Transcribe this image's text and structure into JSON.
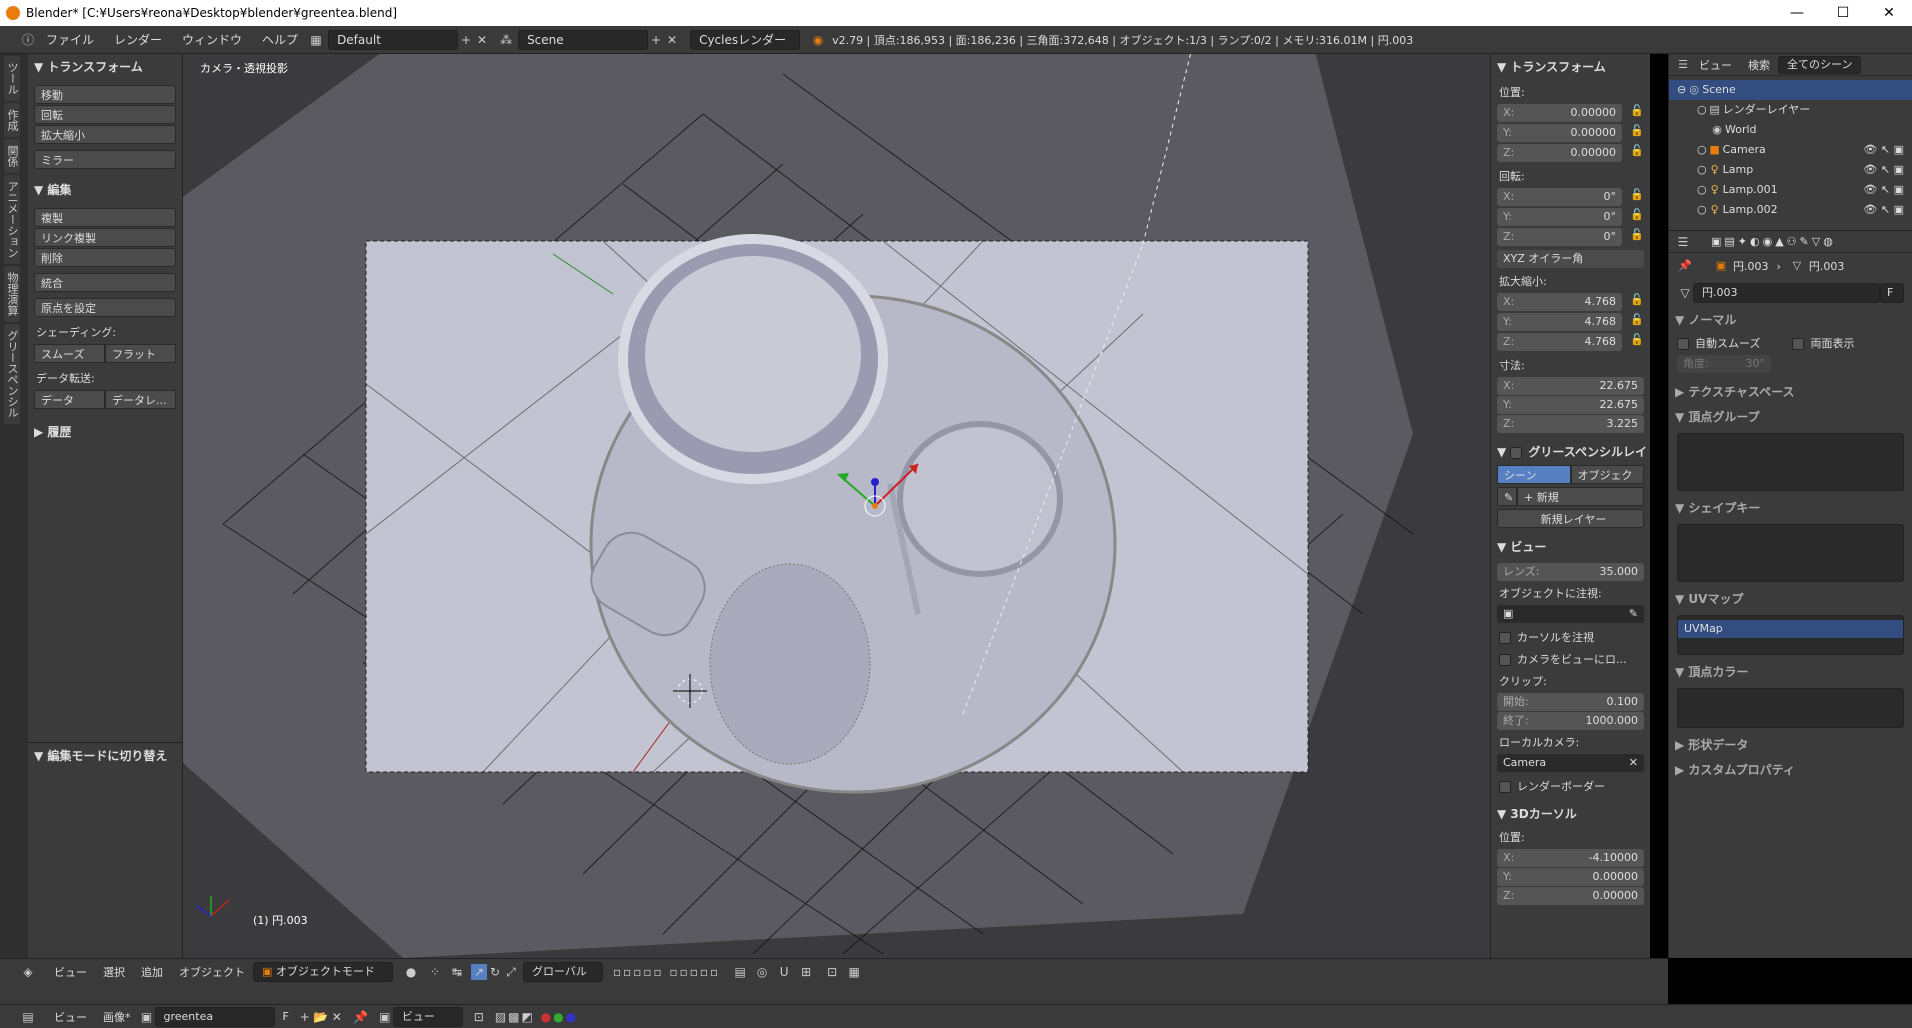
{
  "window": {
    "title": "Blender* [C:¥Users¥reona¥Desktop¥blender¥greentea.blend]"
  },
  "menu": {
    "items": [
      "ファイル",
      "レンダー",
      "ウィンドウ",
      "ヘルプ"
    ],
    "layout": "Default",
    "scene": "Scene",
    "engine": "Cyclesレンダー",
    "stats": "v2.79 | 頂点:186,953 | 面:186,236 | 三角面:372,648 | オブジェクト:1/3 | ランプ:0/2 | メモリ:316.01M | 円.003"
  },
  "lefttabs": [
    "ツール",
    "作成",
    "関係",
    "アニメーション",
    "物理演算",
    "グリースペンシル"
  ],
  "toolshelf": {
    "transform_header": "トランスフォーム",
    "transform": [
      "移動",
      "回転",
      "拡大縮小"
    ],
    "mirror": "ミラー",
    "edit_header": "編集",
    "edit": [
      "複製",
      "リンク複製",
      "削除"
    ],
    "join": "統合",
    "set_origin": "原点を設定",
    "shading_label": "シェーディング:",
    "shading": [
      "スムーズ",
      "フラット"
    ],
    "data_transfer_label": "データ転送:",
    "data_transfer": [
      "データ",
      "データレ..."
    ],
    "history": "履歴",
    "editmode": "編集モードに切り替え"
  },
  "viewport": {
    "label": "カメラ・透視投影",
    "object": "(1) 円.003"
  },
  "npanel": {
    "transform_header": "トランスフォーム",
    "location_label": "位置:",
    "location": [
      {
        "k": "X:",
        "v": "0.00000"
      },
      {
        "k": "Y:",
        "v": "0.00000"
      },
      {
        "k": "Z:",
        "v": "0.00000"
      }
    ],
    "rotation_label": "回転:",
    "rotation": [
      {
        "k": "X:",
        "v": "0°"
      },
      {
        "k": "Y:",
        "v": "0°"
      },
      {
        "k": "Z:",
        "v": "0°"
      }
    ],
    "rotation_mode": "XYZ オイラー角",
    "scale_label": "拡大縮小:",
    "scale": [
      {
        "k": "X:",
        "v": "4.768"
      },
      {
        "k": "Y:",
        "v": "4.768"
      },
      {
        "k": "Z:",
        "v": "4.768"
      }
    ],
    "dims_label": "寸法:",
    "dims": [
      {
        "k": "X:",
        "v": "22.675"
      },
      {
        "k": "Y:",
        "v": "22.675"
      },
      {
        "k": "Z:",
        "v": "3.225"
      }
    ],
    "gp_header": "グリースペンシルレイ",
    "gp_tabs": [
      "シーン",
      "オブジェクト"
    ],
    "gp_new": "新規",
    "gp_newlayer": "新規レイヤー",
    "view_header": "ビュー",
    "lens_k": "レンズ:",
    "lens_v": "35.000",
    "lock_obj": "オブジェクトに注視:",
    "lock_cursor": "カーソルを注視",
    "lock_cam": "カメラをビューにロ...",
    "clip_label": "クリップ:",
    "clip_start_k": "開始:",
    "clip_start_v": "0.100",
    "clip_end_k": "終了:",
    "clip_end_v": "1000.000",
    "local_cam_label": "ローカルカメラ:",
    "local_cam": "Camera",
    "render_border": "レンダーボーダー",
    "cursor_header": "3Dカーソル",
    "cursor_label": "位置:",
    "cursor": [
      {
        "k": "X:",
        "v": "-4.10000"
      },
      {
        "k": "Y:",
        "v": "0.00000"
      },
      {
        "k": "Z:",
        "v": "0.00000"
      }
    ]
  },
  "outliner": {
    "view": "ビュー",
    "search": "検索",
    "filter": "全てのシーン",
    "items": [
      "Scene",
      "レンダーレイヤー",
      "World",
      "Camera",
      "Lamp",
      "Lamp.001",
      "Lamp.002"
    ]
  },
  "props": {
    "crumb1": "円.003",
    "crumb2": "円.003",
    "mesh_name": "円.003",
    "fake": "F",
    "normals": "ノーマル",
    "auto_smooth": "自動スムーズ",
    "double_sided": "両面表示",
    "angle_k": "角度:",
    "angle_v": "30°",
    "texspace": "テクスチャスペース",
    "vgroups": "頂点グループ",
    "shapekeys": "シェイプキー",
    "uvmaps": "UVマップ",
    "uvmap": "UVMap",
    "vcolors": "頂点カラー",
    "geomdata": "形状データ",
    "custom": "カスタムプロパティ"
  },
  "header3d": {
    "items": [
      "ビュー",
      "選択",
      "追加",
      "オブジェクト"
    ],
    "mode": "オブジェクトモード",
    "orient": "グローバル"
  },
  "imgheader": {
    "items": [
      "ビュー",
      "画像*"
    ],
    "image": "greentea",
    "fake": "F",
    "view2": "ビュー"
  }
}
